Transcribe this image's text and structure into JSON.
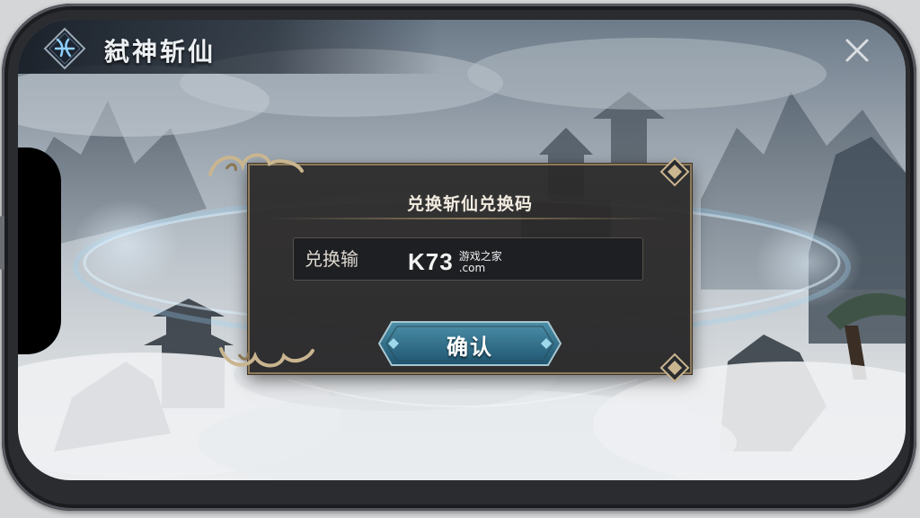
{
  "header": {
    "title": "弑神斩仙",
    "logo_icon": "sword-emblem-icon",
    "close_icon": "close-icon"
  },
  "dialog": {
    "title": "兑换斩仙兑换码",
    "input": {
      "placeholder": "兑换输",
      "value": ""
    },
    "confirm_label": "确认"
  },
  "watermark": {
    "brand": "K73",
    "tagline": "游戏之家",
    "domain": ".com"
  },
  "colors": {
    "dialog_border": "#8c7a5c",
    "button_fill": "#2f6e86",
    "title_text": "#eef1f4"
  }
}
